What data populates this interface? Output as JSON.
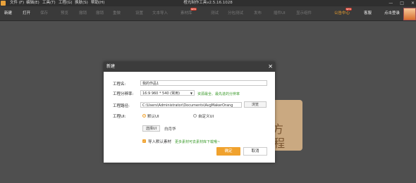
{
  "titlebar": {
    "menu": [
      "文件 (F)",
      "编辑(E)",
      "工具(T)",
      "工程(G)",
      "换肤(S)",
      "帮助(H)"
    ],
    "app_title": "橙光制作工具v2.5.16.1028",
    "controls": [
      "—",
      "□",
      "✕"
    ]
  },
  "toolbar": {
    "items": [
      {
        "label": "新建",
        "active": true
      },
      {
        "label": "打开",
        "active": true
      },
      {
        "label": "保存",
        "active": false
      },
      {
        "label": "预览",
        "active": false
      },
      {
        "label": "撤销",
        "active": false
      },
      {
        "label": "撤销",
        "active": false
      },
      {
        "label": "重做",
        "active": false
      },
      {
        "label": "设置",
        "active": false
      },
      {
        "label": "文本导入",
        "active": false
      },
      {
        "label": "素材库",
        "active": false
      },
      {
        "label": "测试",
        "active": false
      },
      {
        "label": "分包测试",
        "active": false
      },
      {
        "label": "发布",
        "active": false
      },
      {
        "label": "插件UI",
        "active": false
      },
      {
        "label": "显示组件",
        "active": false
      }
    ],
    "badge_new": "NEW",
    "gongzhong": "公告中心",
    "mail": "客服",
    "login": "点击登录"
  },
  "background_card": {
    "text1": "方",
    "text2": "程"
  },
  "dialog": {
    "title": "新建",
    "close": "✕",
    "name_label": "工程名:",
    "name_value": "我的作品1",
    "resolution_label": "工程分辨率:",
    "resolution_value": "16:9  960  * 540  (常用)",
    "resolution_hint": "资源最全、最先进的分辨率",
    "path_label": "工程路径:",
    "path_value": "C:\\Users\\Administrator\\Documents\\AvgMakerOrang",
    "browse_label": "浏览",
    "ui_label": "工程UI:",
    "ui_default": "默认UI",
    "ui_custom": "自定义UI",
    "choose_ui": "选择UI",
    "ui_name": "白月华",
    "import_label": "导入默认素材",
    "import_hint": "更多素材可去素材库下载哦~",
    "ok": "确定",
    "cancel": "取消"
  },
  "colors": {
    "accent": "#f0a22e",
    "hint_green": "#3a9a2a",
    "header": "#3c3c3c"
  }
}
